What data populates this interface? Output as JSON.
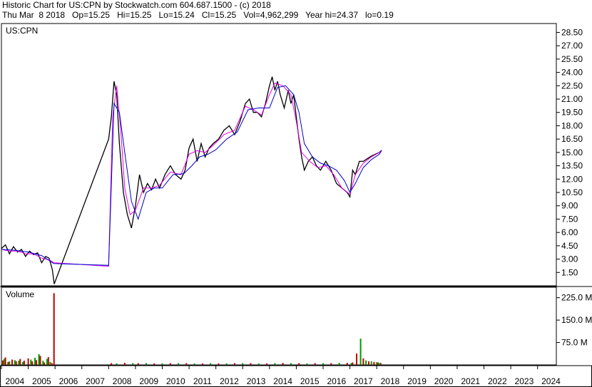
{
  "header": {
    "line1": "Historic Chart for US:CPN by Stockwatch.com 604.687.1500 - (c) 2018",
    "line2": "Thu Mar  8 2018   Op=15.25   Hi=15.25   Lo=15.24   Cl=15.25   Vol=4,962,299   Year hi=24.37   lo=0.19"
  },
  "chart_data": [
    {
      "type": "line",
      "title": "US:CPN",
      "xlabel": "",
      "ylabel": "",
      "x_ticks": [
        "2004",
        "2005",
        "2006",
        "2007",
        "2008",
        "2009",
        "2010",
        "2011",
        "2012",
        "2013",
        "2014",
        "2015",
        "2016",
        "2017",
        "2018",
        "2019",
        "2020",
        "2021",
        "2022",
        "2023",
        "2024"
      ],
      "y_ticks": [
        "1.50",
        "3.00",
        "4.50",
        "6.00",
        "7.50",
        "9.00",
        "10.50",
        "12.00",
        "13.50",
        "15.00",
        "16.50",
        "18.00",
        "19.50",
        "21.00",
        "22.50",
        "24.00",
        "25.50",
        "27.00",
        "28.50"
      ],
      "ylim": [
        0,
        29.5
      ],
      "xlim": [
        2004.0,
        2024.7
      ],
      "grid": false,
      "series": [
        {
          "color": "#000000",
          "x": [
            2004.0,
            2004.15,
            2004.3,
            2004.45,
            2004.6,
            2004.75,
            2004.9,
            2005.05,
            2005.2,
            2005.35,
            2005.5,
            2005.65,
            2005.78,
            2005.9,
            2005.97,
            2008.0,
            2008.1,
            2008.2,
            2008.3,
            2008.4,
            2008.55,
            2008.7,
            2008.85,
            2009.0,
            2009.15,
            2009.3,
            2009.45,
            2009.6,
            2009.75,
            2009.9,
            2010.1,
            2010.3,
            2010.5,
            2010.7,
            2010.85,
            2011.0,
            2011.15,
            2011.3,
            2011.45,
            2011.6,
            2011.75,
            2011.9,
            2012.1,
            2012.3,
            2012.5,
            2012.7,
            2012.9,
            2013.1,
            2013.25,
            2013.4,
            2013.55,
            2013.7,
            2013.85,
            2014.0,
            2014.1,
            2014.2,
            2014.3,
            2014.4,
            2014.55,
            2014.7,
            2014.8,
            2014.9,
            2015.0,
            2015.1,
            2015.2,
            2015.3,
            2015.45,
            2015.6,
            2015.75,
            2015.9,
            2016.1,
            2016.3,
            2016.5,
            2016.7,
            2016.9,
            2017.0,
            2017.1,
            2017.2,
            2017.35,
            2017.5,
            2017.65,
            2017.8,
            2017.95,
            2018.1,
            2018.18
          ],
          "y": [
            4.2,
            4.6,
            3.6,
            4.4,
            3.8,
            4.1,
            3.3,
            3.9,
            3.5,
            3.7,
            2.6,
            3.3,
            3.1,
            1.8,
            0.2,
            16.5,
            19.0,
            23.0,
            21.5,
            16.0,
            10.5,
            8.0,
            6.5,
            9.0,
            12.5,
            10.5,
            11.5,
            10.8,
            12.0,
            11.0,
            12.5,
            13.5,
            12.5,
            12.0,
            13.0,
            15.5,
            16.5,
            14.0,
            16.0,
            14.5,
            15.5,
            16.0,
            16.5,
            17.5,
            18.0,
            17.0,
            18.5,
            20.5,
            21.0,
            19.5,
            19.5,
            19.0,
            20.5,
            22.5,
            23.5,
            22.0,
            23.0,
            21.5,
            20.0,
            22.0,
            20.5,
            21.5,
            19.0,
            16.5,
            14.5,
            13.0,
            14.0,
            14.5,
            13.5,
            13.0,
            14.0,
            13.0,
            11.5,
            11.0,
            10.5,
            10.0,
            13.0,
            12.5,
            14.0,
            14.0,
            14.3,
            14.6,
            14.8,
            15.0,
            15.25
          ]
        },
        {
          "color": "#e600e6",
          "x": [
            2004.0,
            2004.3,
            2004.6,
            2004.9,
            2005.2,
            2005.5,
            2005.8,
            2005.95,
            2008.0,
            2008.15,
            2008.3,
            2008.45,
            2008.6,
            2008.8,
            2009.0,
            2009.3,
            2009.6,
            2009.9,
            2010.3,
            2010.7,
            2011.0,
            2011.3,
            2011.6,
            2011.9,
            2012.3,
            2012.7,
            2013.1,
            2013.4,
            2013.7,
            2014.0,
            2014.2,
            2014.5,
            2014.8,
            2015.0,
            2015.2,
            2015.5,
            2015.8,
            2016.1,
            2016.4,
            2016.7,
            2017.0,
            2017.2,
            2017.5,
            2017.8,
            2018.1,
            2018.18
          ],
          "y": [
            4.1,
            3.9,
            3.9,
            3.6,
            3.6,
            3.1,
            2.9,
            2.6,
            2.2,
            19.0,
            22.5,
            17.5,
            11.0,
            8.0,
            8.5,
            11.0,
            11.0,
            11.3,
            12.8,
            12.5,
            14.8,
            15.2,
            15.0,
            15.8,
            17.0,
            17.5,
            20.2,
            19.8,
            19.2,
            21.5,
            22.8,
            22.5,
            21.5,
            18.5,
            15.0,
            14.0,
            13.3,
            13.5,
            12.5,
            11.0,
            10.3,
            12.5,
            13.8,
            14.5,
            15.0,
            15.2
          ]
        },
        {
          "color": "#0000cc",
          "x": [
            2004.0,
            2004.5,
            2005.0,
            2005.5,
            2005.95,
            2008.0,
            2008.2,
            2008.4,
            2008.6,
            2008.85,
            2009.1,
            2009.4,
            2009.7,
            2010.0,
            2010.4,
            2010.8,
            2011.1,
            2011.4,
            2011.7,
            2012.0,
            2012.4,
            2012.8,
            2013.2,
            2013.6,
            2014.0,
            2014.3,
            2014.6,
            2014.9,
            2015.1,
            2015.3,
            2015.6,
            2015.9,
            2016.2,
            2016.5,
            2016.8,
            2017.0,
            2017.2,
            2017.5,
            2017.8,
            2018.1,
            2018.18
          ],
          "y": [
            4.1,
            4.0,
            3.8,
            3.4,
            2.5,
            2.3,
            20.5,
            19.5,
            15.0,
            9.5,
            7.5,
            10.5,
            11.0,
            11.0,
            12.5,
            12.6,
            13.5,
            14.5,
            14.8,
            15.3,
            16.5,
            17.3,
            19.8,
            20.0,
            20.0,
            22.3,
            22.5,
            21.5,
            19.5,
            16.0,
            14.5,
            13.8,
            13.5,
            13.0,
            11.8,
            10.5,
            11.5,
            13.3,
            14.2,
            14.8,
            15.2
          ]
        }
      ]
    },
    {
      "type": "bar",
      "title": "Volume",
      "y_ticks": [
        "75.0 M",
        "150.0 M",
        "225.0 M"
      ],
      "ylim": [
        0,
        260
      ],
      "series": [
        {
          "color": "#c00000",
          "x": [
            2004.05,
            2004.15,
            2004.25,
            2004.4,
            2004.55,
            2004.7,
            2004.85,
            2005.0,
            2005.15,
            2005.3,
            2005.45,
            2005.6,
            2005.75,
            2005.88,
            2005.96,
            2008.1,
            2008.6,
            2009.1,
            2009.7,
            2010.3,
            2010.9,
            2011.5,
            2012.1,
            2012.7,
            2013.3,
            2013.9,
            2014.5,
            2015.1,
            2015.7,
            2016.3,
            2016.9,
            2017.1,
            2017.25,
            2017.5,
            2017.7,
            2017.9,
            2018.05,
            2018.15
          ],
          "values": [
            15,
            25,
            10,
            18,
            12,
            20,
            14,
            22,
            12,
            16,
            30,
            8,
            26,
            6,
            240,
            6,
            7,
            6,
            5,
            6,
            6,
            5,
            5,
            6,
            6,
            5,
            7,
            6,
            6,
            6,
            7,
            8,
            38,
            22,
            12,
            10,
            8,
            6
          ]
        },
        {
          "color": "#009900",
          "x": [
            2004.1,
            2004.3,
            2004.5,
            2004.65,
            2004.8,
            2005.1,
            2005.25,
            2005.4,
            2005.55,
            2005.7,
            2005.82,
            2008.3,
            2008.9,
            2009.4,
            2010.0,
            2010.6,
            2011.2,
            2011.8,
            2012.4,
            2013.0,
            2013.6,
            2014.2,
            2014.8,
            2015.4,
            2016.0,
            2016.6,
            2017.05,
            2017.4,
            2017.6,
            2017.8,
            2018.0,
            2018.12
          ],
          "values": [
            20,
            12,
            16,
            14,
            10,
            18,
            24,
            36,
            14,
            20,
            10,
            5,
            6,
            6,
            5,
            6,
            5,
            6,
            5,
            6,
            5,
            6,
            6,
            5,
            6,
            7,
            6,
            88,
            15,
            12,
            9,
            7
          ]
        }
      ]
    }
  ]
}
